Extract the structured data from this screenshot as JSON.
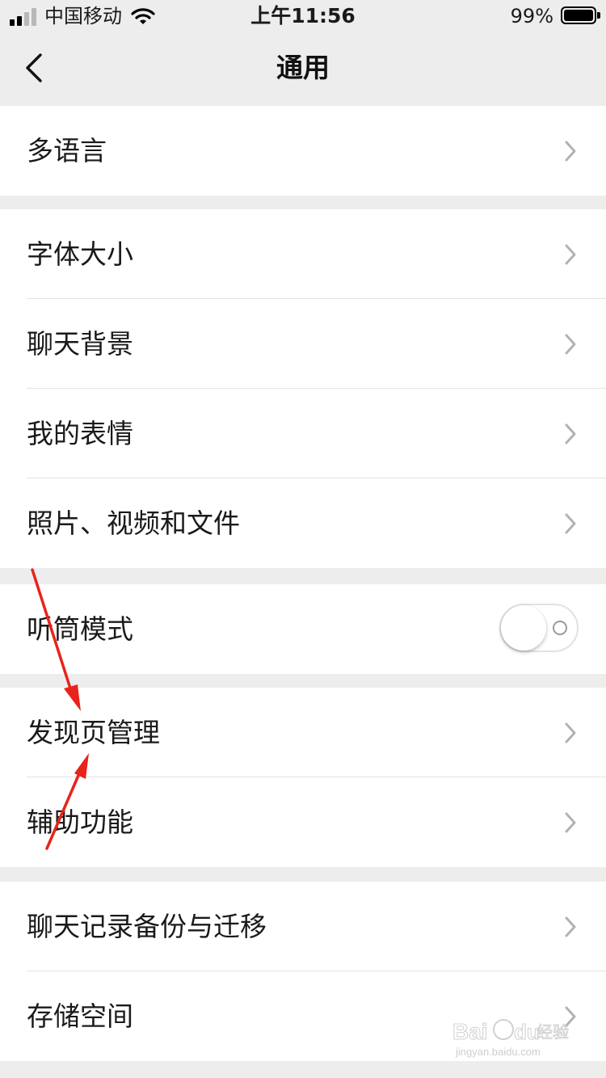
{
  "status_bar": {
    "carrier": "中国移动",
    "time": "上午11:56",
    "battery": "99%"
  },
  "nav": {
    "title": "通用",
    "back_icon": "chevron-left-icon"
  },
  "groups": [
    {
      "rows": [
        {
          "label": "多语言",
          "accessory": "chevron-right-icon"
        }
      ]
    },
    {
      "rows": [
        {
          "label": "字体大小",
          "accessory": "chevron-right-icon"
        },
        {
          "label": "聊天背景",
          "accessory": "chevron-right-icon"
        },
        {
          "label": "我的表情",
          "accessory": "chevron-right-icon"
        },
        {
          "label": "照片、视频和文件",
          "accessory": "chevron-right-icon"
        }
      ]
    },
    {
      "rows": [
        {
          "label": "听筒模式",
          "accessory": "toggle",
          "toggle_on": false
        }
      ]
    },
    {
      "rows": [
        {
          "label": "发现页管理",
          "accessory": "chevron-right-icon"
        },
        {
          "label": "辅助功能",
          "accessory": "chevron-right-icon"
        }
      ]
    },
    {
      "rows": [
        {
          "label": "聊天记录备份与迁移",
          "accessory": "chevron-right-icon"
        },
        {
          "label": "存储空间",
          "accessory": "chevron-right-icon"
        }
      ]
    }
  ],
  "colors": {
    "background": "#ededed",
    "cell": "#ffffff",
    "chevron": "#b2b2b2",
    "annotation_arrow": "#e8231b"
  },
  "watermark": {
    "brand": "Baidu经验",
    "url": "jingyan.baidu.com"
  }
}
